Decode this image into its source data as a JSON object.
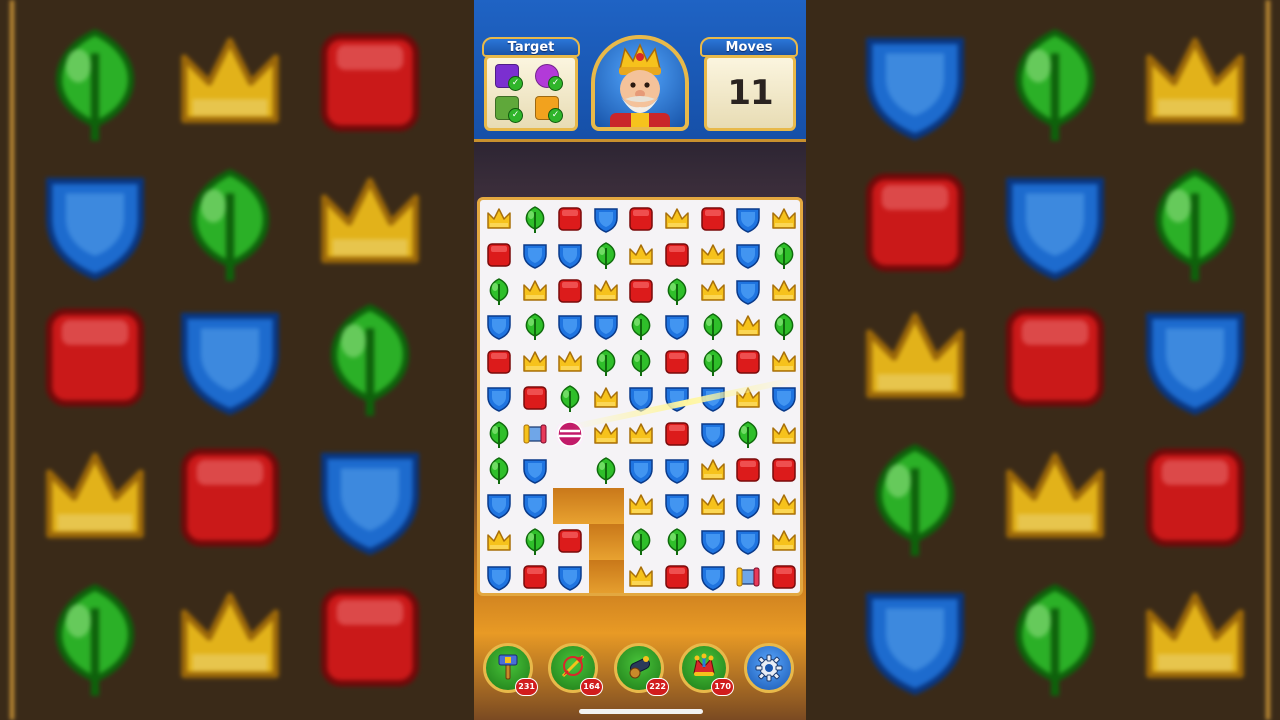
{
  "header": {
    "target_label": "Target",
    "moves_label": "Moves",
    "moves_value": "11"
  },
  "targets": [
    {
      "name": "purple-crown-block-icon",
      "color": "#7b2fd0",
      "completed": true
    },
    {
      "name": "purple-critter-icon",
      "color": "#b23ad8",
      "completed": true
    },
    {
      "name": "grass-tile-icon",
      "color": "#5fa83a",
      "completed": true
    },
    {
      "name": "orange-block-icon",
      "color": "#f2a21e",
      "completed": true
    }
  ],
  "boosters": [
    {
      "name": "hammer-booster",
      "icon": "hammer-icon",
      "count": "231"
    },
    {
      "name": "arrow-booster",
      "icon": "arrow-icon",
      "count": "164"
    },
    {
      "name": "cannon-booster",
      "icon": "cannon-icon",
      "count": "222"
    },
    {
      "name": "jester-hat-booster",
      "icon": "jester-hat-icon",
      "count": "170"
    }
  ],
  "settings_icon": "gear-icon",
  "colors": {
    "crown": "#f6c21c",
    "leaf": "#2fbf2a",
    "red": "#dc1b1b",
    "shield": "#1f74e0",
    "frame_gold": "#e8b94a",
    "header_blue": "#1f63c4"
  },
  "board": {
    "legend": {
      "C": "crown",
      "L": "leaf",
      "R": "red-block",
      "S": "shield",
      "P": "rocket",
      "B": "light-ball",
      "X": "empty"
    },
    "rows": [
      "CLRSRCRSC",
      "RSSLCRCSL",
      "LCRCRLCSC",
      "SLSSLSLCL",
      "RCCLLRLRC",
      "SRLCSSSCS",
      "LPBCCRSLC",
      "LSXLSSCRR",
      "SSXXCSCSC",
      "CLRXLLSSC",
      "SRSXCRSPR"
    ]
  }
}
